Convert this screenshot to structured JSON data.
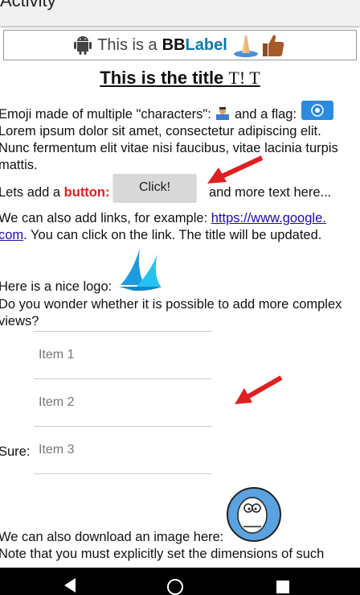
{
  "appbar": {
    "title": "Activity"
  },
  "bblabel": {
    "prefix": "This is a ",
    "bb": "BB",
    "label": "Label"
  },
  "title": {
    "text": "This is the title ",
    "suffix": "T! T"
  },
  "paragraph1": {
    "emoji_line": "Emoji made of multiple \"characters\": ",
    "flag_text": " and a flag: ",
    "lorem1": "Lorem ipsum dolor sit amet, consectetur adipiscing elit.",
    "lorem2": "Nunc fermentum elit vitae nisi faucibus, vitae lacinia turpis",
    "lorem3": "mattis."
  },
  "button_line": {
    "prefix": "Lets add a ",
    "red": "button:",
    "button_label": "Click!",
    "suffix": "and more text here..."
  },
  "links": {
    "line1_prefix": "We can also add links, for example: ",
    "url_part1": "https://www.google.",
    "url_part2": "com",
    "line2_suffix": ". You can click on the link. The title will be updated."
  },
  "logo": {
    "text": "Here is a nice logo:"
  },
  "complex": {
    "line1": "Do you wonder whether it is possible to add more complex",
    "line2": "views?"
  },
  "list": {
    "label": "Sure:",
    "items": [
      "Item 1",
      "Item 2",
      "Item 3"
    ]
  },
  "download": {
    "line1": "We can also download an image here:",
    "line2": "Note that you must explicitly set the dimensions of such"
  },
  "colors": {
    "red": "#e02020",
    "link": "#1a0dab",
    "label_blue": "#0a7aa8"
  }
}
